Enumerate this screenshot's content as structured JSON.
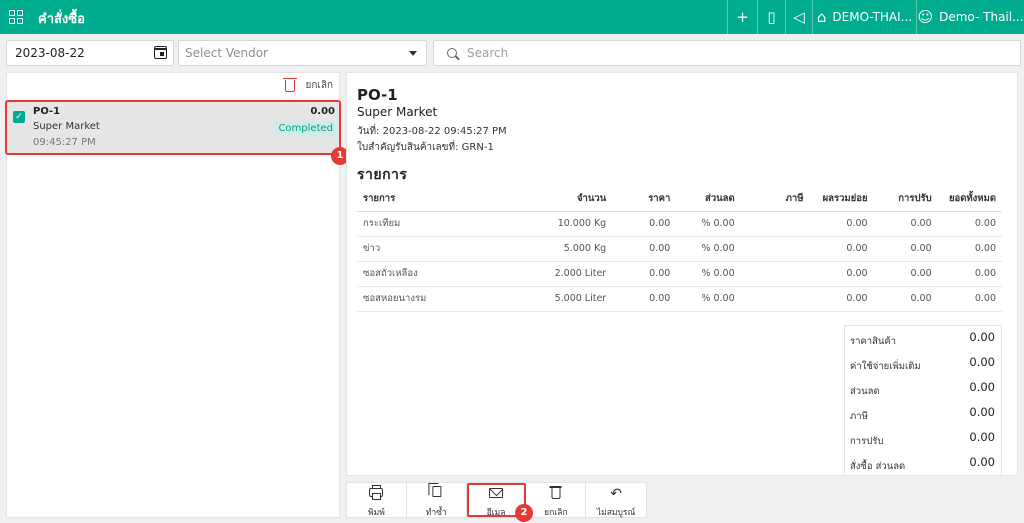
{
  "header": {
    "title": "คำสั่งซื้อ",
    "branch": "DEMO-THAI...",
    "user": "Demo- Thail..."
  },
  "filters": {
    "date": "2023-08-22",
    "vendor_placeholder": "Select Vendor",
    "search_placeholder": "Search"
  },
  "list": {
    "cancel_label": "ยกเลิก",
    "orders": [
      {
        "number": "PO-1",
        "vendor": "Super Market",
        "time": "09:45:27 PM",
        "amount": "0.00",
        "status": "Completed"
      }
    ]
  },
  "detail": {
    "title": "PO-1",
    "vendor": "Super Market",
    "date_label": "วันที่:",
    "date_value": "2023-08-22 09:45:27 PM",
    "receipt_label": "ใบสำคัญรับสินค้าเลขที่:",
    "receipt_value": "GRN-1",
    "items_heading": "รายการ",
    "columns": [
      "รายการ",
      "จำนวน",
      "ราคา",
      "ส่วนลด",
      "ภาษี",
      "ผลรวมย่อย",
      "การปรับ",
      "ยอดทั้งหมด"
    ],
    "rows": [
      {
        "name": "กระเทียม",
        "qty": "10.000 Kg",
        "price": "0.00",
        "discount": "% 0.00",
        "tax": "",
        "subtotal": "0.00",
        "adjust": "0.00",
        "total": "0.00"
      },
      {
        "name": "ข่าว",
        "qty": "5.000 Kg",
        "price": "0.00",
        "discount": "% 0.00",
        "tax": "",
        "subtotal": "0.00",
        "adjust": "0.00",
        "total": "0.00"
      },
      {
        "name": "ซอสถั่วเหลือง",
        "qty": "2.000 Liter",
        "price": "0.00",
        "discount": "% 0.00",
        "tax": "",
        "subtotal": "0.00",
        "adjust": "0.00",
        "total": "0.00"
      },
      {
        "name": "ซอสหอยนางรม",
        "qty": "5.000 Liter",
        "price": "0.00",
        "discount": "% 0.00",
        "tax": "",
        "subtotal": "0.00",
        "adjust": "0.00",
        "total": "0.00"
      }
    ],
    "summary": [
      {
        "label": "ราคาสินค้า",
        "value": "0.00"
      },
      {
        "label": "ค่าใช้จ่ายเพิ่มเติม",
        "value": "0.00"
      },
      {
        "label": "ส่วนลด",
        "value": "0.00"
      },
      {
        "label": "ภาษี",
        "value": "0.00"
      },
      {
        "label": "การปรับ",
        "value": "0.00"
      },
      {
        "label": "สั่งซื้อ ส่วนลด",
        "value": "0.00"
      }
    ]
  },
  "toolbar": {
    "print": "พิมพ์",
    "duplicate": "ทำซ้ำ",
    "email": "อีเมล",
    "cancel": "ยกเลิก",
    "incomplete": "ไม่สมบูรณ์"
  },
  "annotations": {
    "step1": "1",
    "step2": "2"
  },
  "colors": {
    "brand": "#00ac8e",
    "highlight": "#e53935",
    "status_bg": "#d0ece6"
  }
}
